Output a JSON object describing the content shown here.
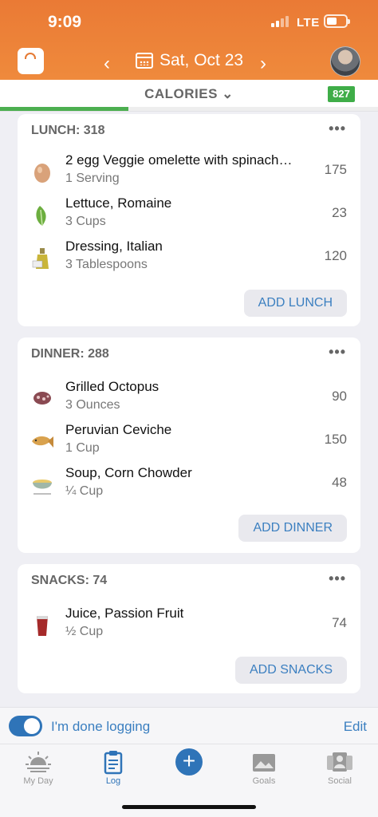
{
  "status_bar": {
    "time": "9:09",
    "network": "LTE"
  },
  "nav": {
    "date": "Sat, Oct 23",
    "prev_icon": "chevron-left-icon",
    "next_icon": "chevron-right-icon"
  },
  "calories_bar": {
    "label": "CALORIES",
    "remaining": "827",
    "progress_fraction": 0.34
  },
  "meals": [
    {
      "title": "LUNCH: 318",
      "add_label": "ADD LUNCH",
      "items": [
        {
          "name": "2 egg Veggie omelette with spinach…",
          "serving": "1 Serving",
          "calories": "175",
          "icon": "egg-icon"
        },
        {
          "name": "Lettuce, Romaine",
          "serving": "3 Cups",
          "calories": "23",
          "icon": "lettuce-icon"
        },
        {
          "name": "Dressing, Italian",
          "serving": "3 Tablespoons",
          "calories": "120",
          "icon": "oil-bottle-icon"
        }
      ]
    },
    {
      "title": "DINNER: 288",
      "add_label": "ADD DINNER",
      "items": [
        {
          "name": "Grilled Octopus",
          "serving": "3 Ounces",
          "calories": "90",
          "icon": "octopus-icon"
        },
        {
          "name": "Peruvian Ceviche",
          "serving": "1 Cup",
          "calories": "150",
          "icon": "fish-icon"
        },
        {
          "name": "Soup, Corn Chowder",
          "serving": "¼ Cup",
          "calories": "48",
          "icon": "soup-bowl-icon"
        }
      ]
    },
    {
      "title": "SNACKS: 74",
      "add_label": "ADD SNACKS",
      "items": [
        {
          "name": "Juice, Passion Fruit",
          "serving": "½ Cup",
          "calories": "74",
          "icon": "juice-glass-icon"
        }
      ]
    }
  ],
  "done_logging": {
    "label": "I'm done logging",
    "edit": "Edit",
    "enabled": true
  },
  "tabs": [
    {
      "label": "My Day",
      "icon": "sunrise-icon"
    },
    {
      "label": "Log",
      "icon": "clipboard-icon",
      "active": true
    },
    {
      "label": "",
      "icon": "plus-icon"
    },
    {
      "label": "Goals",
      "icon": "goals-icon"
    },
    {
      "label": "Social",
      "icon": "social-icon"
    }
  ],
  "colors": {
    "header": "#ea7a35",
    "accent": "#2f74b8",
    "badge": "#3fad48"
  }
}
